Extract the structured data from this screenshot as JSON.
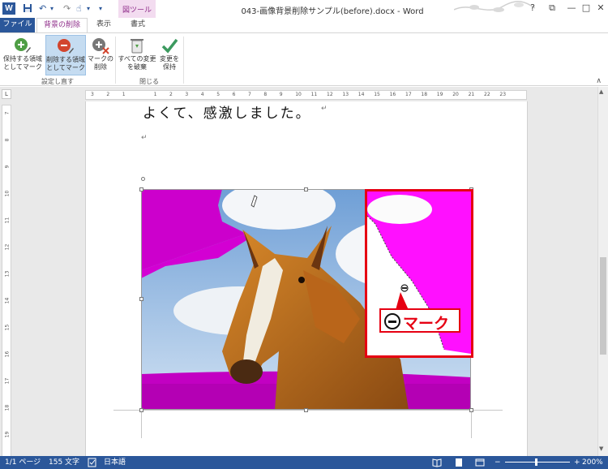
{
  "titlebar": {
    "app_icon": "W",
    "title": "043-画像背景削除サンプル(before).docx - Word",
    "context_tab_label": "図ツール",
    "help": "?",
    "restore": "⧉",
    "minimize": "—",
    "maximize": "□",
    "close": "✕",
    "qat": {
      "save": "💾",
      "undo": "↶",
      "undo_drop": "▾",
      "redo": "↷",
      "touch": "☝",
      "touch_drop": "▾",
      "customize": "▾"
    }
  },
  "tabs": {
    "file": "ファイル",
    "background_removal": "背景の削除",
    "view": "表示",
    "format": "書式"
  },
  "ribbon": {
    "mark_keep_line1": "保持する領域",
    "mark_keep_line2": "としてマーク",
    "mark_remove_line1": "削除する領域",
    "mark_remove_line2": "としてマーク",
    "delete_mark_line1": "マークの",
    "delete_mark_line2": "削除",
    "group_refine": "設定し直す",
    "discard_line1": "すべての変更",
    "discard_line2": "を破棄",
    "keep_changes_line1": "変更を",
    "keep_changes_line2": "保持",
    "group_close": "閉じる",
    "collapse": "∧"
  },
  "ruler": {
    "corner": "L",
    "h_numbers": [
      "3",
      "2",
      "1",
      "",
      "1",
      "2",
      "3",
      "4",
      "5",
      "6",
      "7",
      "8",
      "9",
      "10",
      "11",
      "12",
      "13",
      "14",
      "15",
      "16",
      "17",
      "18",
      "19",
      "20",
      "21",
      "22",
      "23"
    ],
    "v_numbers": [
      "7",
      "8",
      "9",
      "10",
      "11",
      "12",
      "13",
      "14",
      "15",
      "16",
      "17",
      "18",
      "19",
      "20"
    ]
  },
  "document": {
    "body_text": "よくて、感激しました。",
    "return_mark": "↵",
    "empty_para_mark": "↵"
  },
  "callout": {
    "label": "マーク"
  },
  "statusbar": {
    "page": "1/1 ページ",
    "words": "155 文字",
    "language": "日本語",
    "zoom_minus": "−",
    "zoom_plus": "+",
    "zoom": "200%"
  },
  "colors": {
    "word_blue": "#2b579a",
    "context_magenta": "#8f2d8a",
    "removal_magenta": "#cc00cc",
    "callout_red": "#e60012"
  }
}
